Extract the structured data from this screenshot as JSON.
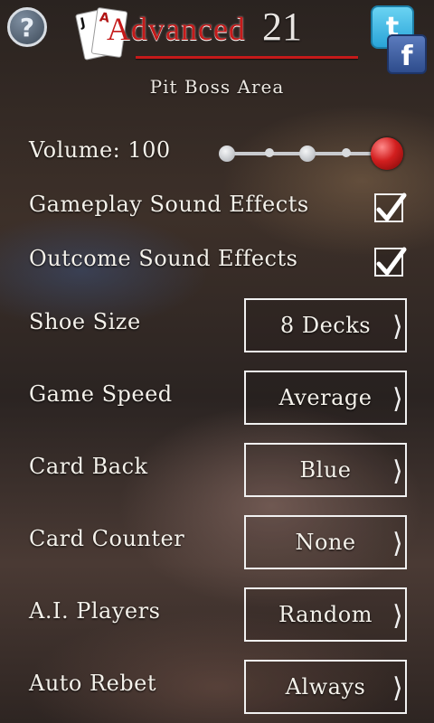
{
  "header": {
    "help_glyph": "?",
    "logo_word": "Advanced",
    "logo_number": "21",
    "card_left": "J",
    "card_right": "A",
    "twitter_glyph": "t",
    "facebook_glyph": "f",
    "subtitle": "Pit Boss Area"
  },
  "settings": {
    "volume": {
      "label": "Volume: 100",
      "value": 100
    },
    "gameplay_sfx": {
      "label": "Gameplay Sound Effects",
      "checked": true
    },
    "outcome_sfx": {
      "label": "Outcome Sound Effects",
      "checked": true
    },
    "rows": [
      {
        "label": "Shoe Size",
        "value": "8 Decks"
      },
      {
        "label": "Game Speed",
        "value": "Average"
      },
      {
        "label": "Card Back",
        "value": "Blue"
      },
      {
        "label": "Card Counter",
        "value": "None"
      },
      {
        "label": "A.I. Players",
        "value": "Random"
      },
      {
        "label": "Auto Rebet",
        "value": "Always"
      }
    ]
  },
  "colors": {
    "logo_red": "#c51a1a",
    "knob_red": "#d21f1f",
    "twitter_blue": "#2aa4d8",
    "facebook_blue": "#2e4c8c"
  },
  "icons": [
    "help-icon",
    "twitter-icon",
    "facebook-icon",
    "checkmark-icon",
    "chevron-right-icon"
  ]
}
